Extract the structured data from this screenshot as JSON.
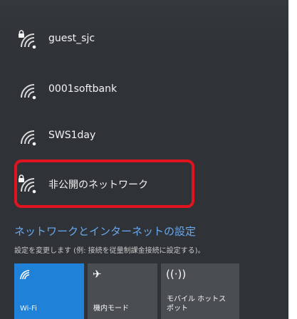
{
  "networks": [
    {
      "name": "guest_sjc",
      "secured": true,
      "selected": false
    },
    {
      "name": "0001softbank",
      "secured": false,
      "selected": false
    },
    {
      "name": "SWS1day",
      "secured": false,
      "selected": false
    },
    {
      "name": "非公開のネットワーク",
      "secured": true,
      "selected": true
    }
  ],
  "settings": {
    "link": "ネットワークとインターネットの設定",
    "description": "設定を変更します (例: 接続を従量制課金接続に設定する)。"
  },
  "quick_actions": [
    {
      "label": "Wi-Fi",
      "active": true,
      "icon": "wifi-icon"
    },
    {
      "label": "機内モード",
      "active": false,
      "icon": "airplane-icon"
    },
    {
      "label": "モバイル ホットス\nポット",
      "active": false,
      "icon": "hotspot-icon"
    }
  ],
  "colors": {
    "panel": "#2f3337",
    "accent": "#1f82d8",
    "link": "#69a8f0",
    "highlight_border": "#e0141e"
  }
}
